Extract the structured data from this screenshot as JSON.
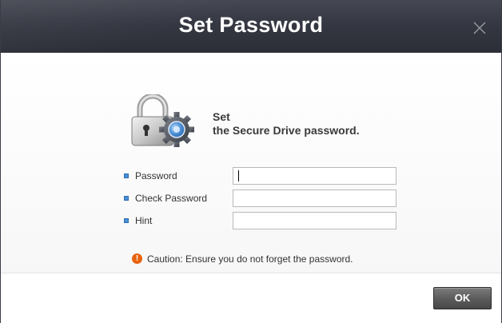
{
  "dialog": {
    "title": "Set Password",
    "close_icon": "close-icon"
  },
  "heading": {
    "line1": "Set",
    "line2": "the Secure Drive password."
  },
  "lock_icon": "lock-gear-icon",
  "fields": [
    {
      "label": "Password",
      "value": "",
      "placeholder": ""
    },
    {
      "label": "Check Password",
      "value": "",
      "placeholder": ""
    },
    {
      "label": "Hint",
      "value": "",
      "placeholder": ""
    }
  ],
  "caution": {
    "icon": "caution-icon",
    "text": "Caution: Ensure you do not forget the password."
  },
  "buttons": {
    "ok_label": "OK"
  },
  "colors": {
    "titlebar": "#353842",
    "bullet": "#4a8fd6",
    "caution_icon": "#e8630f",
    "ok_button": "#5d5d5d"
  }
}
